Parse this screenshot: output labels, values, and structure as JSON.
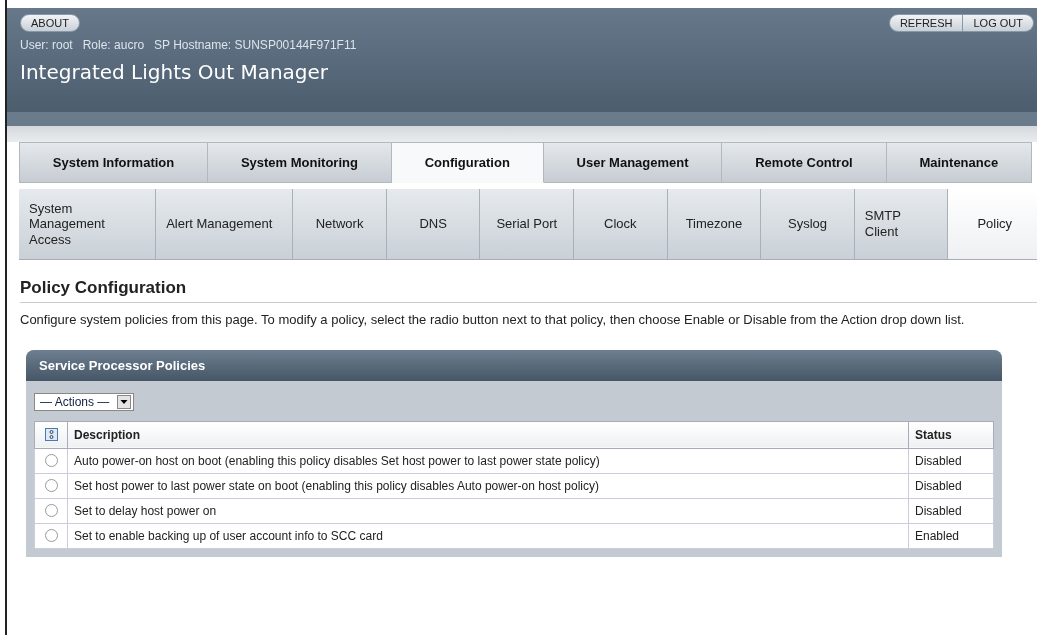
{
  "header": {
    "about_button": "ABOUT",
    "refresh_button": "REFRESH",
    "logout_button": "LOG OUT",
    "user_info": "User: root   Role: aucro   SP Hostname: SUNSP00144F971F11",
    "title": "Integrated Lights Out Manager"
  },
  "tabs": [
    {
      "label": "System Information",
      "selected": false
    },
    {
      "label": "System Monitoring",
      "selected": false
    },
    {
      "label": "Configuration",
      "selected": true
    },
    {
      "label": "User Management",
      "selected": false
    },
    {
      "label": "Remote Control",
      "selected": false
    },
    {
      "label": "Maintenance",
      "selected": false
    }
  ],
  "subtabs": [
    {
      "label": "System Management Access",
      "selected": false
    },
    {
      "label": "Alert Management",
      "selected": false
    },
    {
      "label": "Network",
      "selected": false
    },
    {
      "label": "DNS",
      "selected": false
    },
    {
      "label": "Serial Port",
      "selected": false
    },
    {
      "label": "Clock",
      "selected": false
    },
    {
      "label": "Timezone",
      "selected": false
    },
    {
      "label": "Syslog",
      "selected": false
    },
    {
      "label": "SMTP Client",
      "selected": false
    },
    {
      "label": "Policy",
      "selected": true
    }
  ],
  "page": {
    "title": "Policy Configuration",
    "description": "Configure system policies from this page. To modify a policy, select the radio button next to that policy, then choose Enable or Disable from the Action drop down list."
  },
  "panel": {
    "title": "Service Processor Policies",
    "actions_dropdown": "— Actions —",
    "columns": [
      "Description",
      "Status"
    ],
    "rows": [
      {
        "description": "Auto power-on host on boot (enabling this policy disables Set host power to last power state policy)",
        "status": "Disabled",
        "selected": false
      },
      {
        "description": "Set host power to last power state on boot (enabling this policy disables Auto power-on host policy)",
        "status": "Disabled",
        "selected": false
      },
      {
        "description": "Set to delay host power on",
        "status": "Disabled",
        "selected": false
      },
      {
        "description": "Set to enable backing up of user account info to SCC card",
        "status": "Enabled",
        "selected": false
      }
    ]
  }
}
